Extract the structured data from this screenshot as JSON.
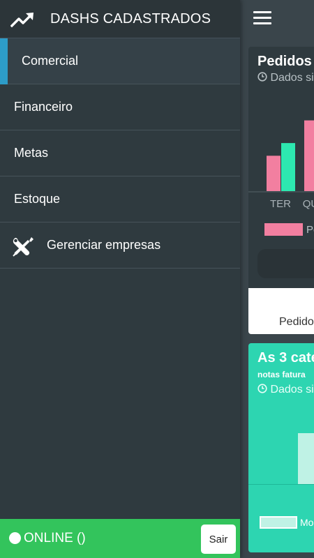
{
  "drawer": {
    "title": "DASHS CADASTRADOS",
    "logo_icon": "trending-up-icon",
    "items": [
      {
        "label": "Comercial",
        "active": true
      },
      {
        "label": "Financeiro"
      },
      {
        "label": "Metas"
      },
      {
        "label": "Estoque"
      },
      {
        "label": "Gerenciar empresas",
        "icon": "tools-icon"
      }
    ]
  },
  "status": {
    "text": "ONLINE ()",
    "logout_label": "Sair",
    "color": "#33c45c"
  },
  "main": {
    "menu_icon": "hamburger-menu-icon",
    "card1": {
      "title": "Pedidos",
      "subtitle": "Dados si",
      "clock_icon": "clock-icon",
      "legend": "Pe",
      "footer": "Pedido",
      "chart_data": {
        "type": "bar",
        "categories": [
          "TER",
          "QU"
        ],
        "series": [
          {
            "values": [
              0.39,
              null
            ],
            "color": "#f27fa0"
          },
          {
            "values": [
              0.53,
              null
            ],
            "color": "#2de8b0"
          },
          {
            "values": [
              null,
              0.78
            ],
            "color": "#f27fa0"
          }
        ]
      }
    },
    "card2": {
      "title": "As 3 cate",
      "small": "notas fatura",
      "subtitle": "Dados si",
      "legend": "Mo",
      "chart_data": {
        "type": "bar",
        "categories": [
          ""
        ],
        "values": [
          0.55
        ]
      }
    }
  },
  "colors": {
    "accent": "#2d9cc8",
    "drawer_bg": "#2f3a3f",
    "card2_bg": "#2dd5b1",
    "pink": "#f27fa0",
    "teal": "#2de8b0"
  }
}
